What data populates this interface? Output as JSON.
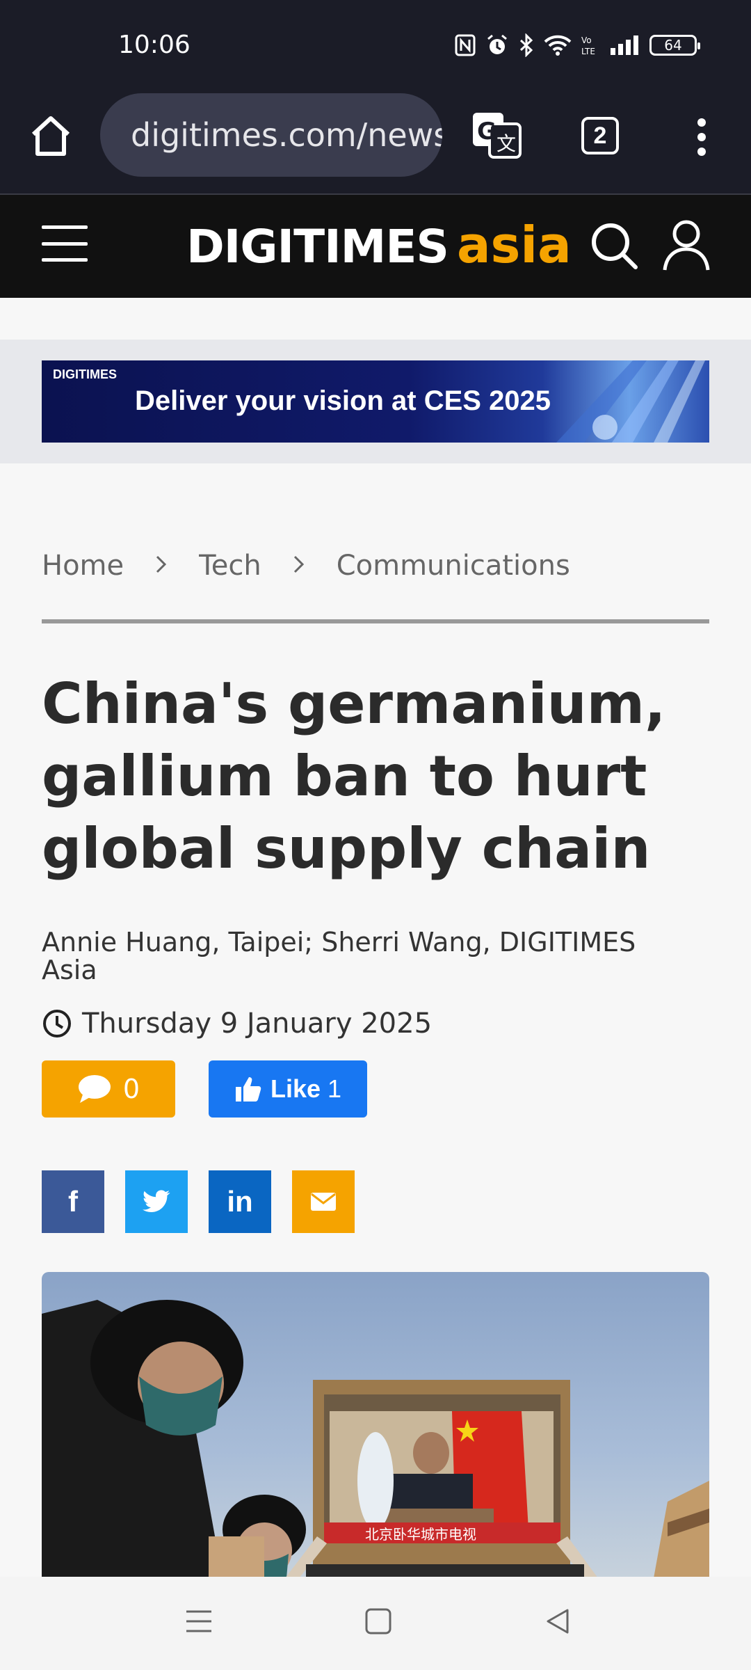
{
  "status_bar": {
    "time": "10:06",
    "battery": "64",
    "icons": [
      "nfc-icon",
      "alarm-icon",
      "bluetooth-icon",
      "wifi-icon",
      "volte-icon",
      "signal-icon",
      "battery-icon"
    ]
  },
  "browser": {
    "url": "digitimes.com/news",
    "tab_count": "2"
  },
  "site": {
    "logo_main": "DIGITIMES",
    "logo_accent": "asia",
    "accent_color": "#f5a300"
  },
  "ad": {
    "brand": "DIGITIMES",
    "text": "Deliver your vision at CES 2025"
  },
  "breadcrumb": [
    "Home",
    "Tech",
    "Communications"
  ],
  "article": {
    "title": "China's germanium, gallium ban to hurt global supply chain",
    "authors": "Annie Huang, Taipei; Sherri Wang, DIGITIMES Asia",
    "date": "Thursday 9 January 2025",
    "comment_count": "0",
    "like_label": "Like",
    "like_count": "1"
  },
  "share": {
    "facebook": "f",
    "twitter": "twitter-icon",
    "linkedin": "in",
    "email": "email-icon"
  },
  "hero_image": {
    "screen_text": "北京卧华城市电视"
  }
}
